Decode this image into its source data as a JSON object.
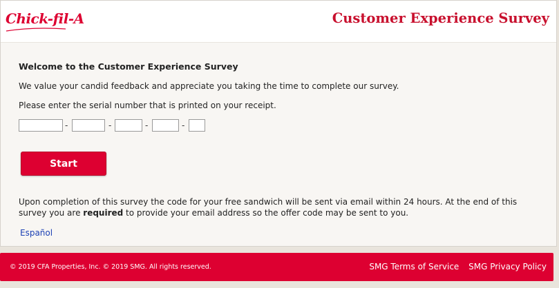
{
  "header": {
    "logo_text": "Chick-fil-A",
    "title": "Customer Experience Survey"
  },
  "main": {
    "welcome": "Welcome to the Customer Experience Survey",
    "intro": "We value your candid feedback and appreciate you taking the time to complete our survey.",
    "prompt": "Please enter the serial number that is printed on your receipt.",
    "serial_fields": [
      "",
      "",
      "",
      "",
      ""
    ],
    "serial_separator": "-",
    "start_label": "Start",
    "note_before": "Upon completion of this survey the code for your free sandwich will be sent via email within 24 hours. At the end of this survey you are ",
    "note_bold": "required",
    "note_after": " to provide your email address so the offer code may be sent to you.",
    "language_link": "Español"
  },
  "footer": {
    "copyright": "© 2019 CFA Properties, Inc. © 2019 SMG. All rights reserved.",
    "terms_link": "SMG Terms of Service",
    "privacy_link": "SMG Privacy Policy"
  },
  "colors": {
    "brand_red": "#dd0031",
    "title_red": "#c8102e",
    "link_blue": "#1a3fb4"
  }
}
